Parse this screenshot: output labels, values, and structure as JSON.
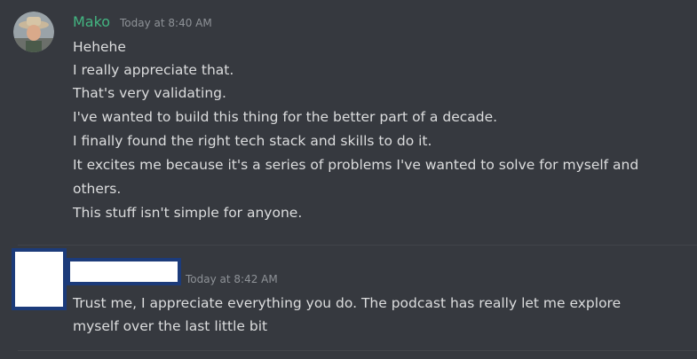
{
  "messages": [
    {
      "author": "Mako",
      "author_color": "#43b581",
      "timestamp": "Today at 8:40 AM",
      "lines": [
        "Hehehe",
        "I really appreciate that.",
        "That's very validating.",
        "I've wanted to build this thing for the better part of a decade.",
        "I finally found the right tech stack and skills to do it.",
        "It excites me because it's a series of problems I've wanted to solve for myself and",
        "others.",
        "This stuff isn't simple for anyone."
      ]
    },
    {
      "author": "",
      "timestamp": "Today at 8:42 AM",
      "lines": [
        "Trust me, I appreciate everything you do. The podcast has really let me explore",
        "myself over the last little bit"
      ]
    }
  ],
  "colors": {
    "background": "#36393f",
    "text": "#dcddde",
    "timestamp": "#8e9297",
    "redaction_border": "#1c3b7a"
  }
}
